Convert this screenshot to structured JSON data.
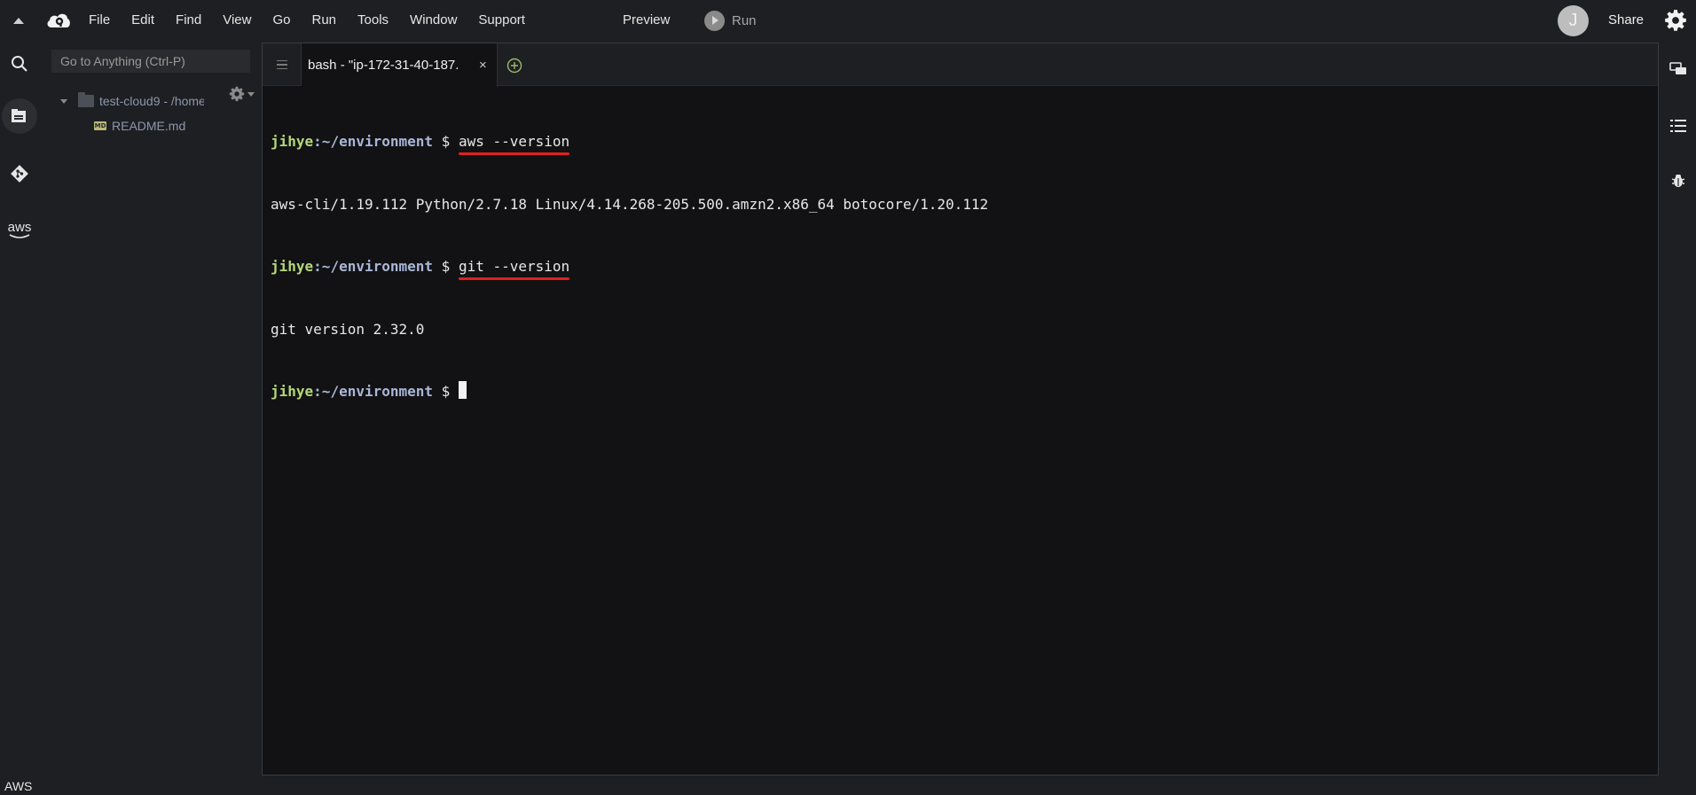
{
  "menubar": {
    "items": [
      "File",
      "Edit",
      "Find",
      "View",
      "Go",
      "Run",
      "Tools",
      "Window",
      "Support"
    ],
    "preview_label": "Preview",
    "run_label": "Run",
    "avatar_letter": "J",
    "share_label": "Share"
  },
  "left_rail": {
    "icons": [
      "search-icon",
      "files-icon",
      "git-icon",
      "aws-icon"
    ],
    "aws_label": "aws",
    "footer_label": "AWS"
  },
  "file_tree": {
    "goto_placeholder": "Go to Anything (Ctrl-P)",
    "root_label": "test-cloud9 - /home",
    "file_label": "README.md"
  },
  "terminal": {
    "tab_title": "bash - \"ip-172-31-40-187.",
    "prompt_user": "jihye",
    "prompt_path": ":~/environment",
    "prompt_symbol": " $ ",
    "lines": [
      {
        "type": "prompt",
        "command": "aws --version"
      },
      {
        "type": "output",
        "text": "aws-cli/1.19.112 Python/2.7.18 Linux/4.14.268-205.500.amzn2.x86_64 botocore/1.20.112"
      },
      {
        "type": "prompt",
        "command": "git --version"
      },
      {
        "type": "output",
        "text": "git version 2.32.0"
      },
      {
        "type": "prompt",
        "command": ""
      }
    ]
  },
  "colors": {
    "prompt_user": "#b5d87a",
    "prompt_path": "#a9b6d6",
    "underline": "#e02020",
    "background": "#121214"
  }
}
